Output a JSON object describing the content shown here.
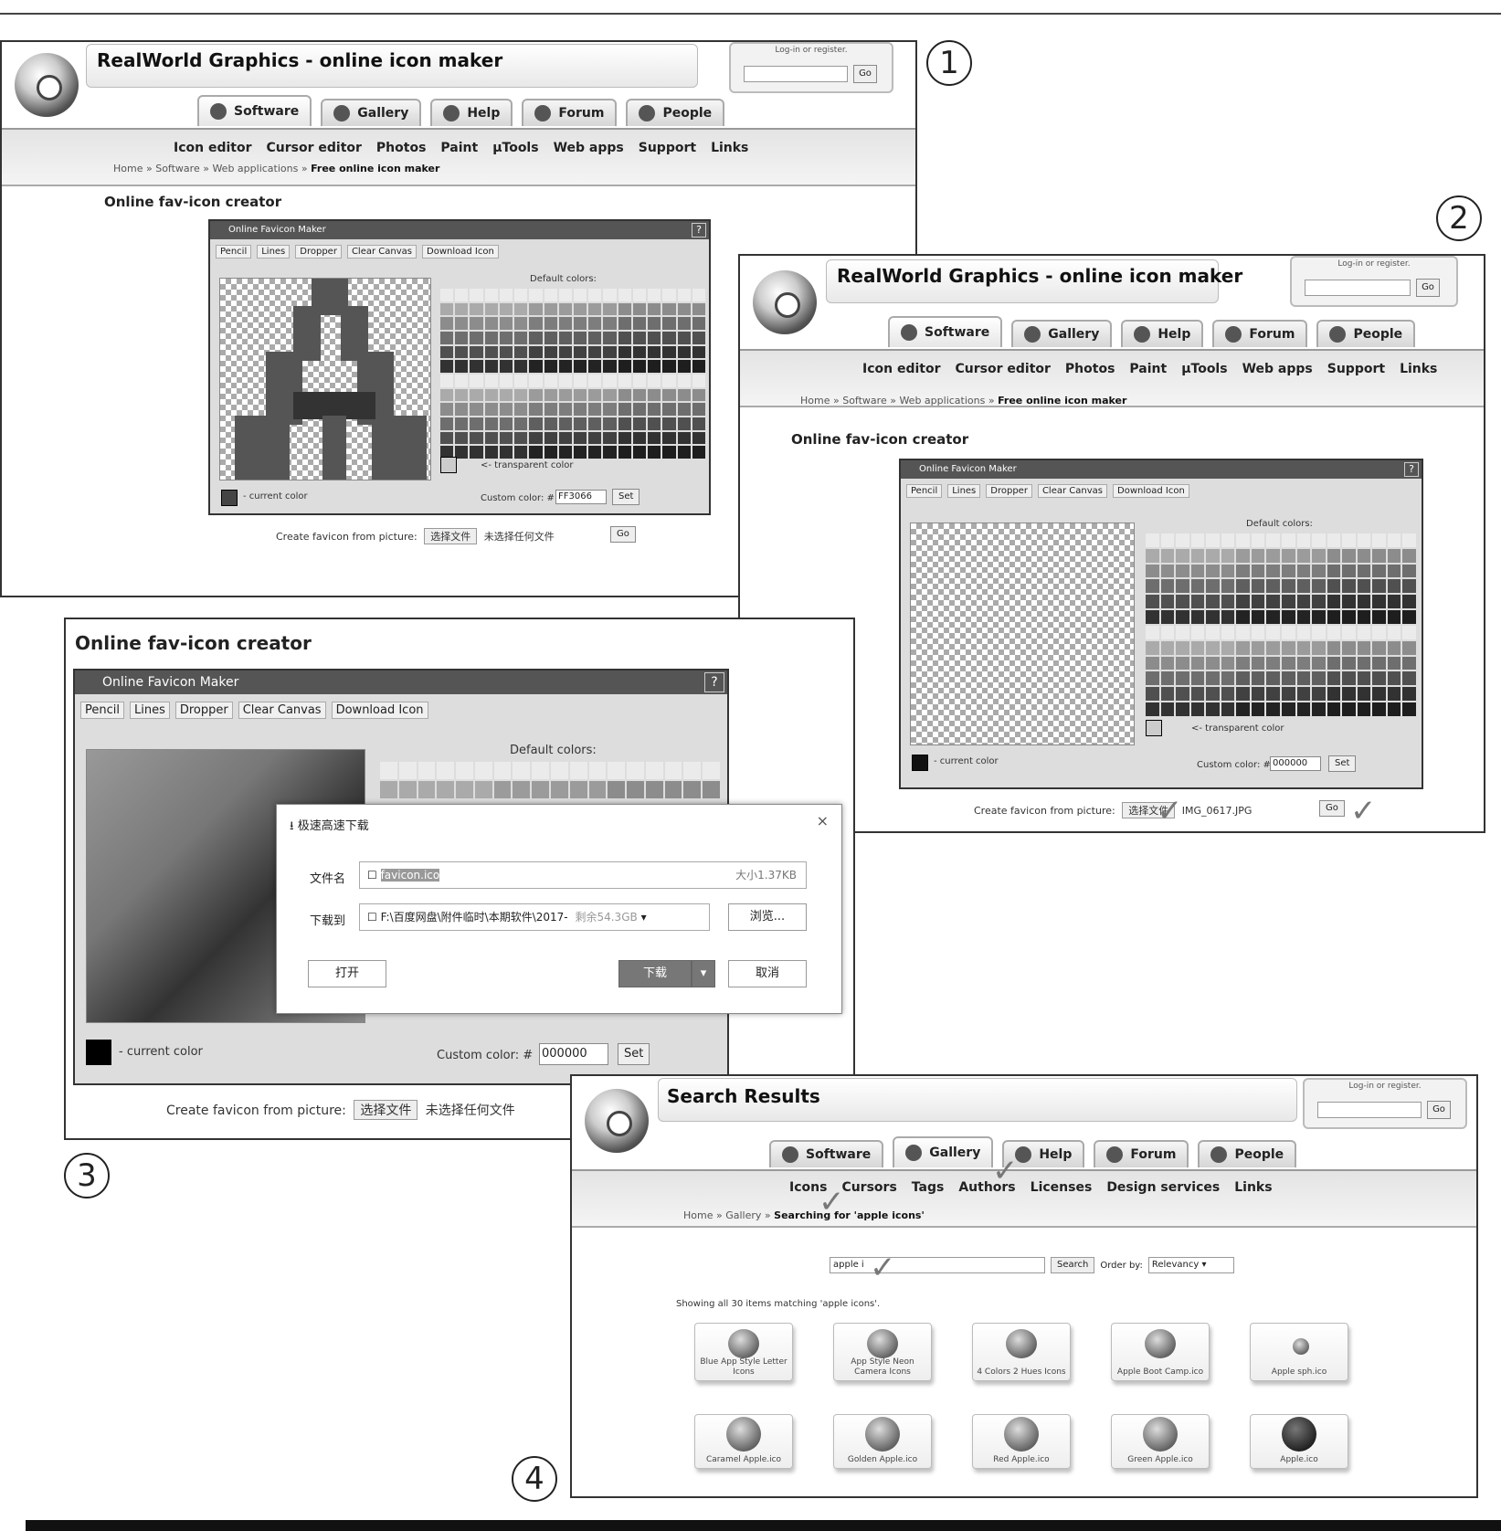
{
  "figure_numbers": [
    "1",
    "2",
    "3",
    "4"
  ],
  "site": {
    "title": "RealWorld Graphics - online icon maker",
    "login_label": "Log-in or register.",
    "go": "Go",
    "tabs": [
      "Software",
      "Gallery",
      "Help",
      "Forum",
      "People"
    ],
    "subnav": [
      "Icon editor",
      "Cursor editor",
      "Photos",
      "Paint",
      "μTools",
      "Web apps",
      "Support",
      "Links"
    ],
    "crumbs": [
      "Home",
      "Software",
      "Web applications",
      "Free online icon maker"
    ],
    "crumb_sep": "»",
    "page_heading": "Online fav-icon creator"
  },
  "maker": {
    "title": "Online Favicon Maker",
    "help": "?",
    "tools": [
      "Pencil",
      "Lines",
      "Dropper",
      "Clear Canvas",
      "Download Icon"
    ],
    "default_colors": "Default colors:",
    "transparent": "<- transparent color",
    "current_color": "- current color",
    "custom_color": "Custom color: #",
    "set": "Set",
    "create_from_picture": "Create favicon from picture:",
    "choose_file": "选择文件",
    "no_file": "未选择任何文件"
  },
  "shot1": {
    "custom_value": "FF3066"
  },
  "shot2": {
    "custom_value": "000000",
    "file_name": "IMG_0617.JPG"
  },
  "shot3": {
    "custom_value": "000000",
    "dialog": {
      "title": "极速高速下载",
      "close": "×",
      "filename_label": "文件名",
      "filename": "favicon.ico",
      "size": "大小1.37KB",
      "saveto_label": "下载到",
      "path": "F:\\百度网盘\\附件临时\\本期软件\\2017-",
      "free": "剩余54.3GB",
      "browse": "浏览...",
      "open": "打开",
      "download": "下载",
      "cancel": "取消"
    }
  },
  "shot4": {
    "title": "Search Results",
    "subnav": [
      "Icons",
      "Cursors",
      "Tags",
      "Authors",
      "Licenses",
      "Design services",
      "Links"
    ],
    "crumbs": [
      "Home",
      "Gallery",
      "Searching for 'apple icons'"
    ],
    "query": "apple i",
    "search_btn": "Search",
    "order_label": "Order by:",
    "order_value": "Relevancy",
    "result_count": "Showing all 30 items matching 'apple icons'.",
    "results": [
      "Blue App Style Letter Icons",
      "App Style Neon Camera Icons",
      "4 Colors 2 Hues Icons",
      "Apple Boot Camp.ico",
      "Apple sph.ico",
      "Caramel Apple.ico",
      "Golden Apple.ico",
      "Red Apple.ico",
      "Green Apple.ico",
      "Apple.ico"
    ]
  },
  "colors": {
    "accent": "#555555",
    "checker": "#aaaaaa"
  }
}
